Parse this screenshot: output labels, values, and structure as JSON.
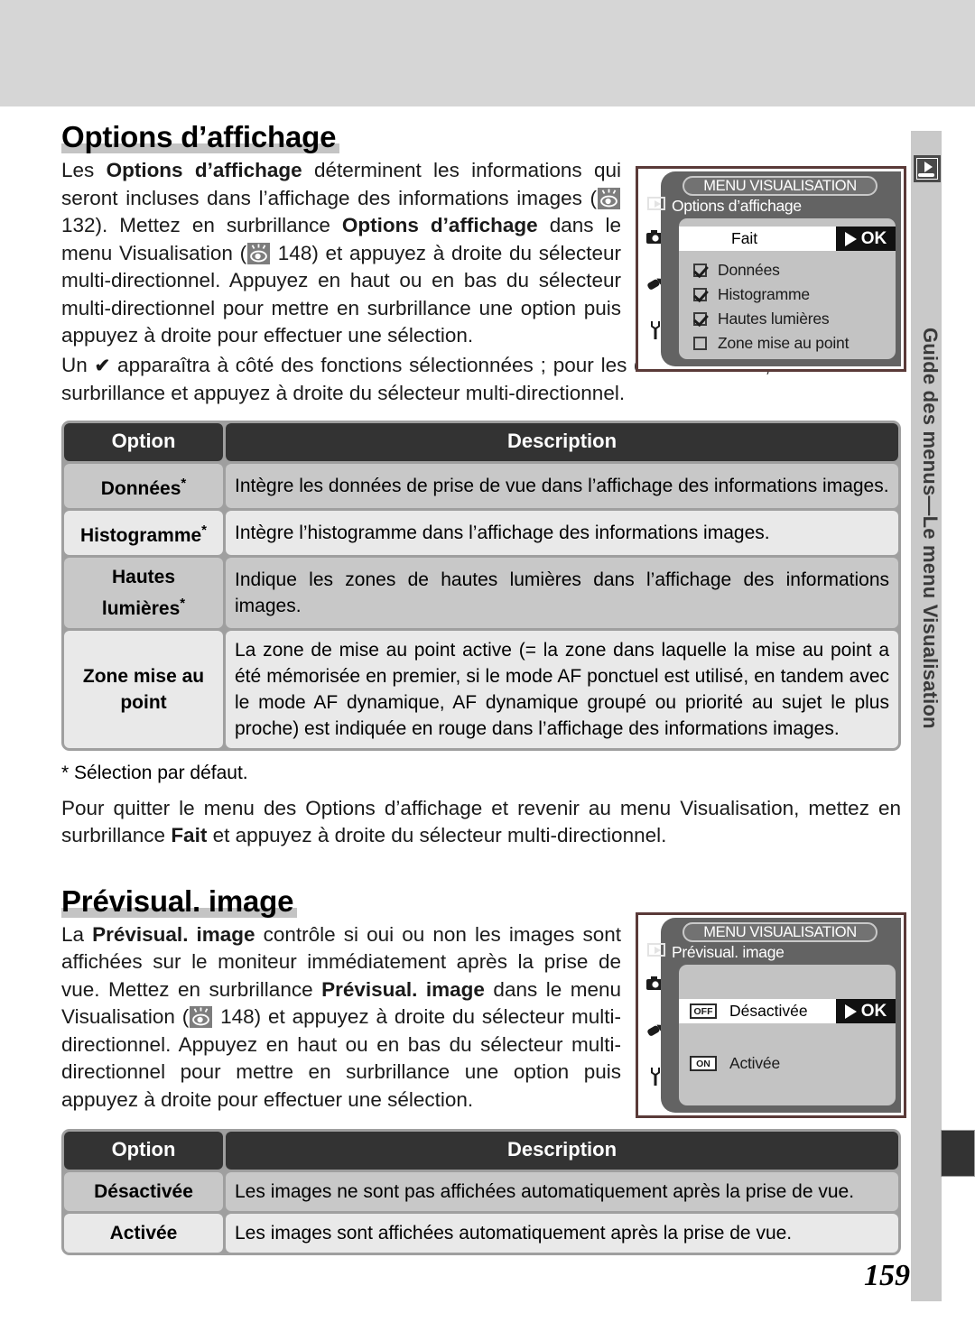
{
  "page": {
    "number": "159",
    "side_tab": {
      "label": "Guide des menus—Le menu Visualisation",
      "icon": "playback-icon"
    }
  },
  "section1": {
    "title": "Options d’affichage",
    "paragraph_runs": [
      {
        "t": "Les ",
        "b": false
      },
      {
        "t": "Options d’affichage",
        "b": true
      },
      {
        "t": " déterminent les informations qui seront incluses dans l’affichage des informations images (",
        "b": false
      },
      {
        "t": "EYE",
        "b": false
      },
      {
        "t": " 132). Mettez en surbrillance ",
        "b": false
      },
      {
        "t": "Options d’affichage",
        "b": true
      },
      {
        "t": " dans le menu Visualisation (",
        "b": false
      },
      {
        "t": "EYE",
        "b": false
      },
      {
        "t": " 148) et appuyez à droite du sélecteur multi-directionnel. Appuyez en haut ou en bas du sélecteur multi-directionnel pour mettre en surbrillance une option puis appuyez à droite pour effectuer une sélection.",
        "b": false
      }
    ],
    "paragraph2_pre": "Un ",
    "paragraph2_check": "✔",
    "paragraph2_post": " apparaîtra à côté des fonctions sélectionnées ; pour les désélectionner, mettez-les en surbrillance et appuyez à droite du sélecteur multi-directionnel.",
    "screenshot": {
      "menu_title": "MENU VISUALISATION",
      "subtitle": "Options d’affichage",
      "selected_label": "Fait",
      "ok_label": "OK",
      "items": [
        {
          "label": "Données",
          "checked": true
        },
        {
          "label": "Histogramme",
          "checked": true
        },
        {
          "label": "Hautes lumières",
          "checked": true
        },
        {
          "label": "Zone mise au point",
          "checked": false
        }
      ],
      "rail_icons": [
        "playback-icon",
        "camera-icon",
        "pencil-icon",
        "wrench-icon"
      ]
    },
    "table": {
      "headers": [
        "Option",
        "Description"
      ],
      "rows": [
        {
          "option": "Données",
          "star": true,
          "description": "Intègre les données de prise de vue dans l’affichage des informations images."
        },
        {
          "option": "Histogramme",
          "star": true,
          "description": "Intègre l’histogramme dans l’affichage des informations images."
        },
        {
          "option": "Hautes lumières",
          "star": true,
          "description": "Indique les zones de hautes lumières dans l’affichage des informations images."
        },
        {
          "option": "Zone mise au point",
          "star": false,
          "description": "La zone de mise au point active (= la zone dans laquelle la mise au point a été mémorisée en premier, si le mode AF ponctuel est utilisé, en tandem avec le mode AF dynamique, AF dynamique groupé ou priorité au sujet le plus proche) est indiquée en rouge dans l’affichage des informations images."
        }
      ]
    },
    "footnote": "* Sélection par défaut.",
    "closing_pre": "Pour quitter le menu des Options d’affichage et revenir au menu Visualisation, mettez en surbrillance ",
    "closing_bold": "Fait",
    "closing_post": " et appuyez à droite du sélecteur multi-directionnel."
  },
  "section2": {
    "title": "Prévisual. image",
    "paragraph_runs": [
      {
        "t": "La ",
        "b": false
      },
      {
        "t": "Prévisual. image",
        "b": true
      },
      {
        "t": " contrôle si oui ou non les images sont affichées sur le moniteur immédiatement après la prise de vue. Mettez en surbrillance ",
        "b": false
      },
      {
        "t": "Prévisual. image",
        "b": true
      },
      {
        "t": " dans le menu Visualisation (",
        "b": false
      },
      {
        "t": "EYE",
        "b": false
      },
      {
        "t": " 148) et appuyez à droite du sélecteur multi-directionnel. Appuyez en haut ou en bas du sélecteur multi-directionnel pour mettre en surbrillance une option puis appuyez à droite pour effectuer une sélection.",
        "b": false
      }
    ],
    "screenshot": {
      "menu_title": "MENU VISUALISATION",
      "subtitle": "Prévisual. image",
      "ok_label": "OK",
      "items": [
        {
          "badge": "OFF",
          "label": "Désactivée",
          "selected": true
        },
        {
          "badge": "ON",
          "label": "Activée",
          "selected": false
        }
      ],
      "rail_icons": [
        "playback-icon",
        "camera-icon",
        "pencil-icon",
        "wrench-icon"
      ]
    },
    "table": {
      "headers": [
        "Option",
        "Description"
      ],
      "rows": [
        {
          "option": "Désactivée",
          "description": "Les images ne sont pas affichées automatiquement après la prise de vue."
        },
        {
          "option": "Activée",
          "description": "Les images sont affichées automatiquement après la prise de vue."
        }
      ]
    }
  },
  "colors": {
    "top_band": "#d6d6d6",
    "rail": "#c9c9c9",
    "table_header": "#333333",
    "row_shade": "#c8c8c8",
    "row_light": "#e9e9e9",
    "screenshot_border": "#5a3a38",
    "lcd_panel": "#636363",
    "lcd_list": "#c3c3c3"
  }
}
